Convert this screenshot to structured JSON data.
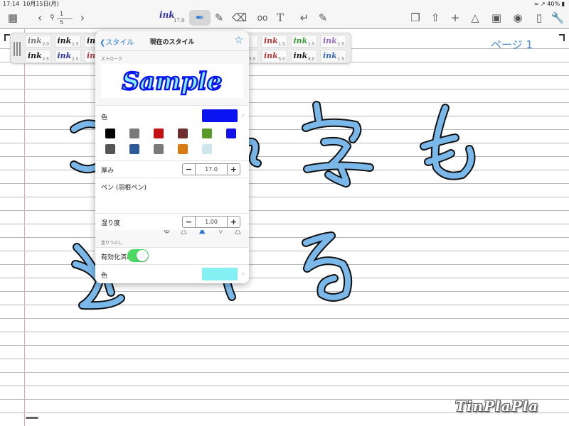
{
  "status": {
    "time": "17:14",
    "date": "10月15日(月)",
    "battery": "40%"
  },
  "toolbar": {
    "left_icons": [
      "library-icon",
      "back-icon",
      "search-icon",
      "forward-icon"
    ],
    "page_current": "1",
    "page_total": "5",
    "ink_label": "ink",
    "ink_size": "17.0",
    "text_tool_label": "T",
    "right_icons": [
      "add-page-icon",
      "share-icon",
      "add-icon",
      "shapes-icon",
      "image-icon",
      "camera-icon",
      "clipboard-icon",
      "wrench-icon"
    ]
  },
  "page": {
    "label": "ページ 1"
  },
  "palette": {
    "ink_label": "ink",
    "row1": [
      {
        "size": "2.0",
        "color": "#7b7b7b"
      },
      {
        "size": "1.5",
        "color": "#1a1a1a"
      },
      {
        "size": "",
        "color": "#1a1a1a"
      },
      {
        "size": "",
        "color": "#1a1a1a"
      },
      {
        "size": "",
        "color": "#1a1a1a"
      },
      {
        "size": "",
        "color": "#1a1a1a"
      },
      {
        "size": "",
        "color": "#1a1a1a"
      },
      {
        "size": "",
        "color": "#1a1a1a"
      },
      {
        "size": "1.5",
        "color": "#b23a3a"
      },
      {
        "size": "1.5",
        "color": "#3a9a3a"
      },
      {
        "size": "1.5",
        "color": "#9a6ac8"
      }
    ],
    "row2": [
      {
        "size": "2.5",
        "color": "#1a1a1a"
      },
      {
        "size": "2.5",
        "color": "#2f2fa8"
      },
      {
        "size": "",
        "color": "#b23a3a"
      },
      {
        "size": "",
        "color": "#1a1a1a"
      },
      {
        "size": "",
        "color": "#1a1a1a"
      },
      {
        "size": "",
        "color": "#1a1a1a"
      },
      {
        "size": "",
        "color": "#1a1a1a"
      },
      {
        "size": "3.5",
        "color": "#1a1a1a"
      },
      {
        "size": "5.0",
        "color": "#b23a3a"
      },
      {
        "size": "8.0",
        "color": "#1a1a1a"
      },
      {
        "size": "1.5",
        "color": "#3a6ac8"
      }
    ]
  },
  "popover": {
    "back_label": "スタイル",
    "title": "現在のスタイル",
    "stroke_section": "ストローク",
    "sample_text": "Sample",
    "color_label": "色",
    "stroke_color": "#0a14f0",
    "palette_colors": [
      "#000000",
      "#7a7a7a",
      "#c41212",
      "#6e2e2e",
      "#5a9a2a",
      "#1212e8",
      "#555555",
      "#2e5a9a",
      "#7a7a7a",
      "#d87a12",
      "#cfe6ec"
    ],
    "thickness_label": "厚み",
    "thickness_value": "17.0",
    "pen_label": "ペン (羽根ペン)",
    "wetness_label": "湿り度",
    "wetness_value": "1.00",
    "fill_section": "塗りつぶし",
    "fill_enabled_label": "有効化済み",
    "fill_color_label": "色",
    "fill_color": "#84f0f4"
  },
  "watermark": "TinPlaPla"
}
